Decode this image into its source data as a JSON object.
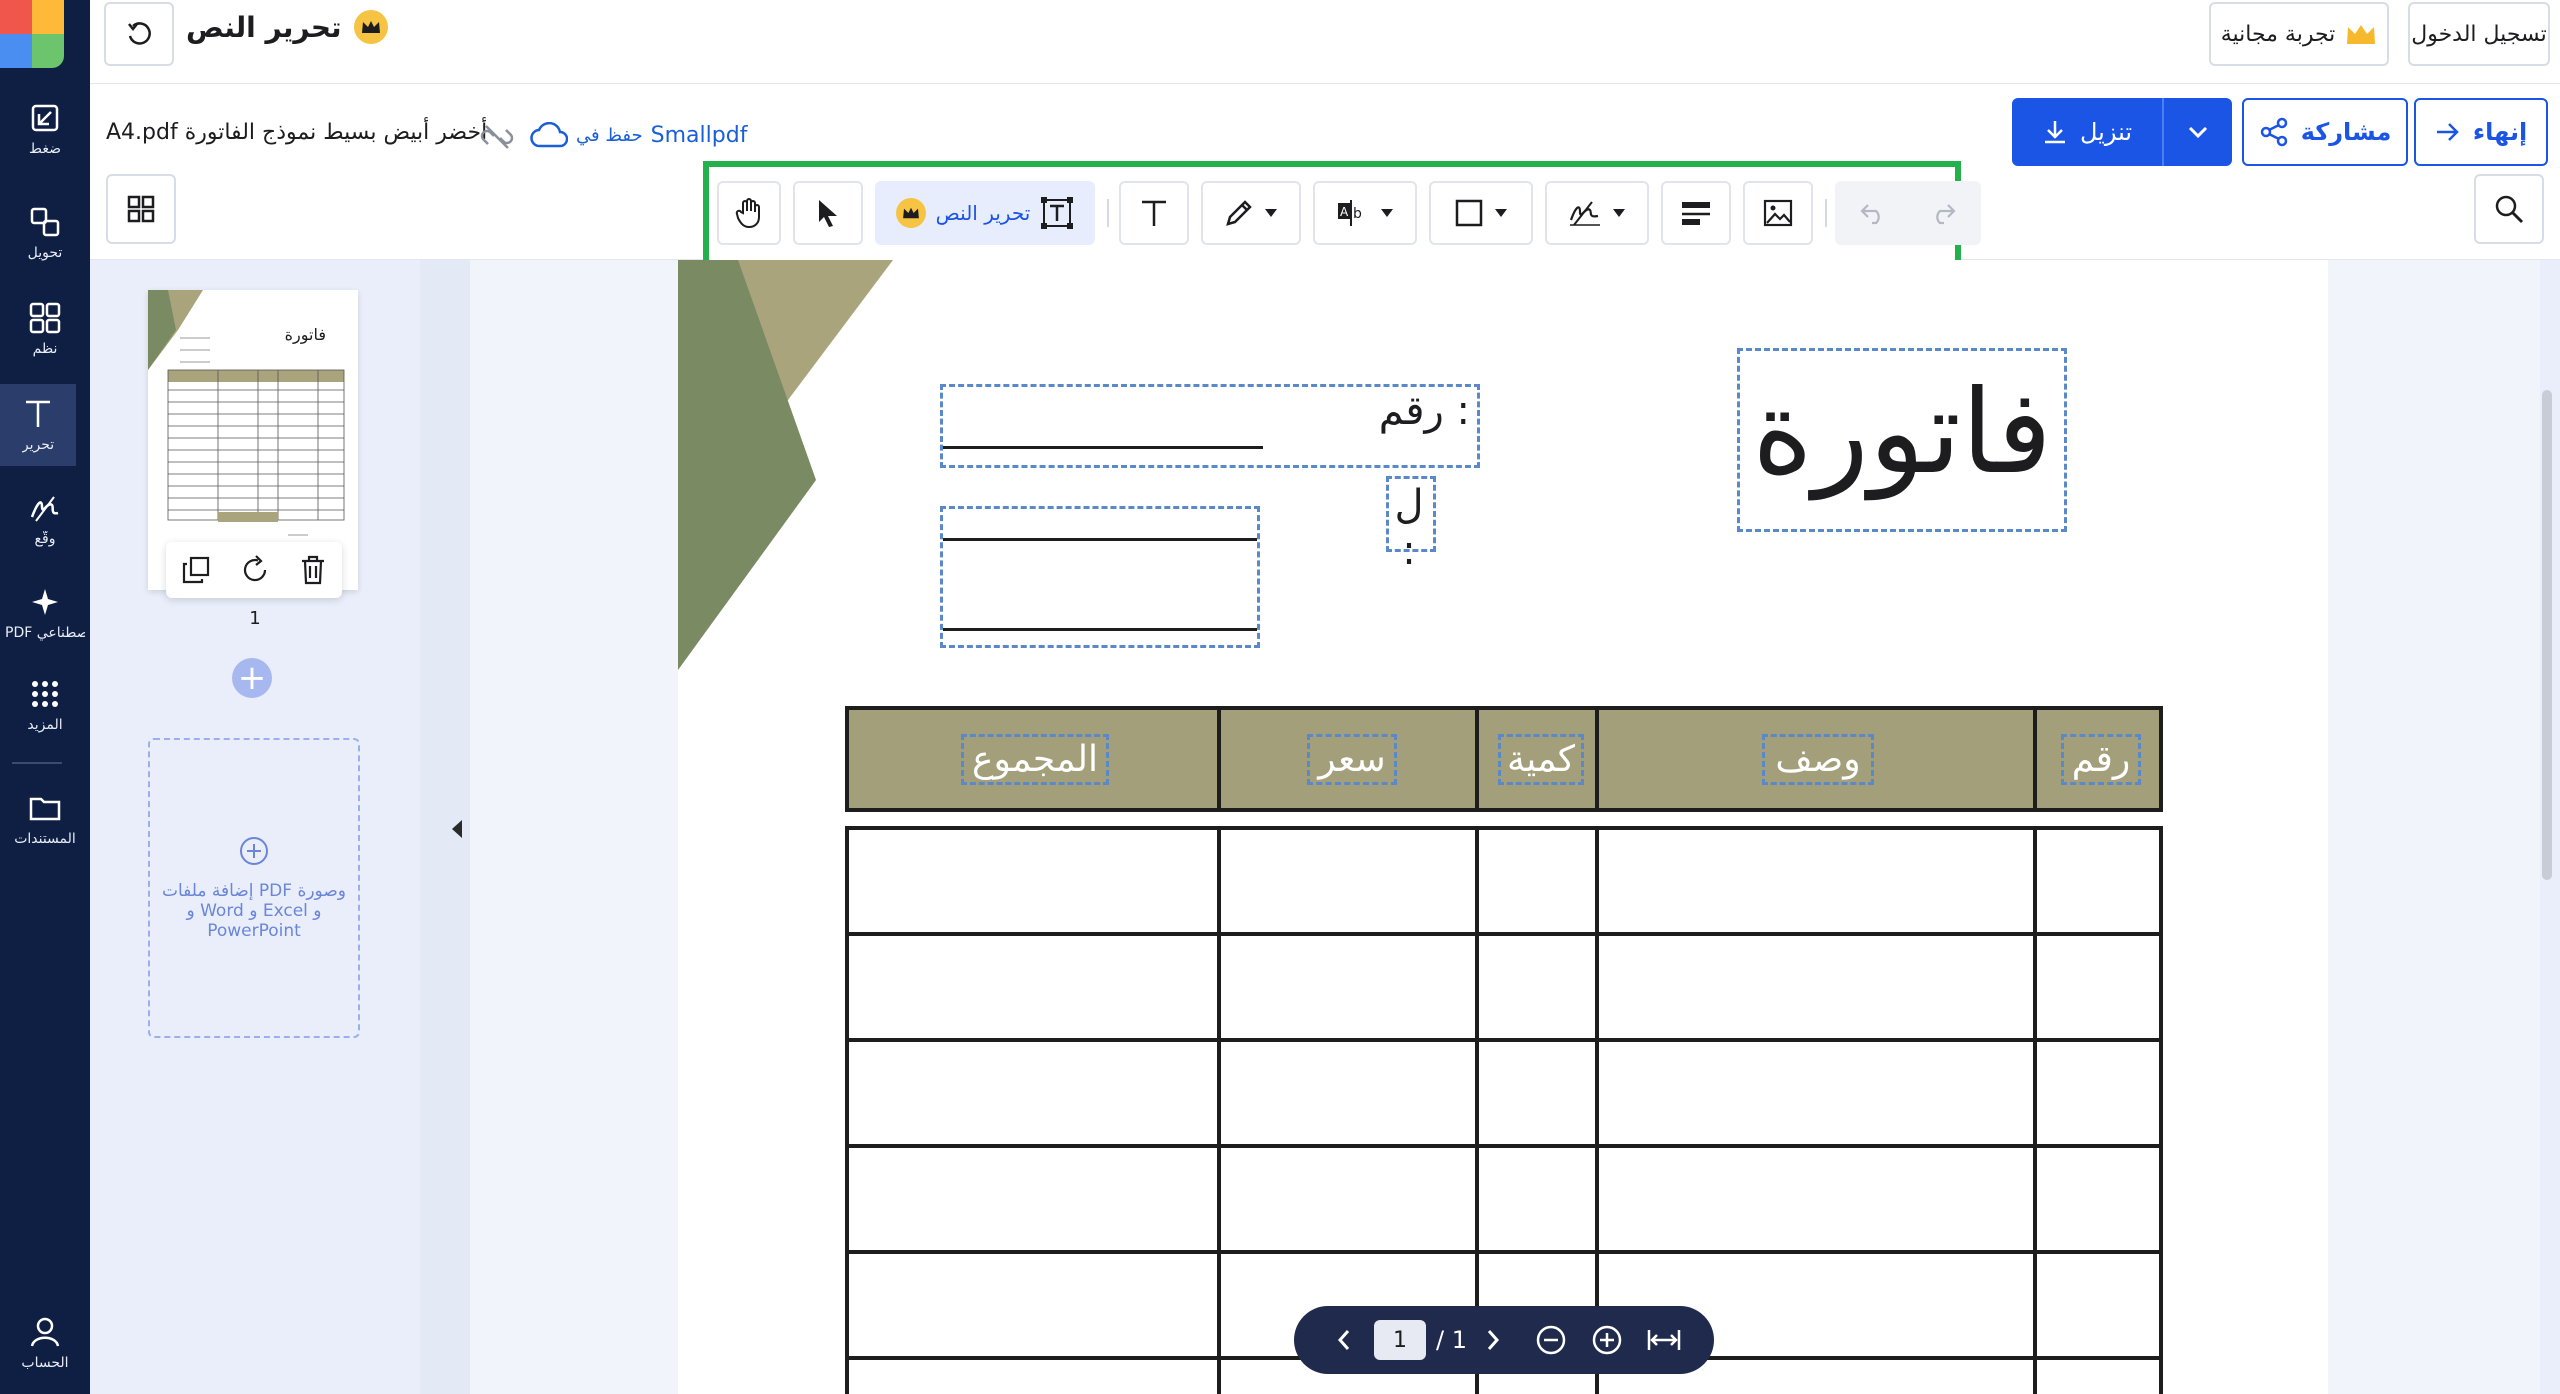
{
  "leftnav": {
    "items": [
      {
        "label": "ضغط",
        "icon": "compress-icon"
      },
      {
        "label": "تحويل",
        "icon": "convert-icon"
      },
      {
        "label": "نظم",
        "icon": "organize-icon"
      },
      {
        "label": "تحرير",
        "icon": "edit-text-icon"
      },
      {
        "label": "وقّع",
        "icon": "sign-icon"
      },
      {
        "label": "PDF ذكاء اصطناعي...",
        "icon": "ai-sparkle-icon"
      },
      {
        "label": "المزيد",
        "icon": "more-grid-icon"
      },
      {
        "label": "المستندات",
        "icon": "folder-icon"
      },
      {
        "label": "الحساب",
        "icon": "account-icon"
      }
    ]
  },
  "header": {
    "title": "تحرير النص",
    "login_label": "تسجيل الدخول",
    "trial_label": "تجربة مجانية"
  },
  "file": {
    "name": "A4.pdf أخضر أبيض بسيط نموذج الفاتورة",
    "saved_label": "حفظ في",
    "saved_service": "Smallpdf"
  },
  "actions": {
    "download_label": "تنزيل",
    "share_label": "مشاركة",
    "finish_label": "إنهاء"
  },
  "toolbar": {
    "edit_text_label": "تحرير النص"
  },
  "thumbnails": {
    "page_number": "1",
    "thumb_title": "فاتورة",
    "dropzone_text": "إضافة ملفات PDF وصورة و Word و Excel و PowerPoint"
  },
  "document": {
    "title": "فاتورة",
    "number_label": "رقم :",
    "to_label": "ل :",
    "table_headers": [
      "رقم",
      "وصف",
      "كمية",
      "سعر",
      "المجموع"
    ],
    "colors": {
      "header_bg": "#a39f7a",
      "shape_dark": "#7a8a62",
      "shape_light": "#a9a47c"
    }
  },
  "pagenav": {
    "current": "1",
    "total": "/ 1"
  }
}
